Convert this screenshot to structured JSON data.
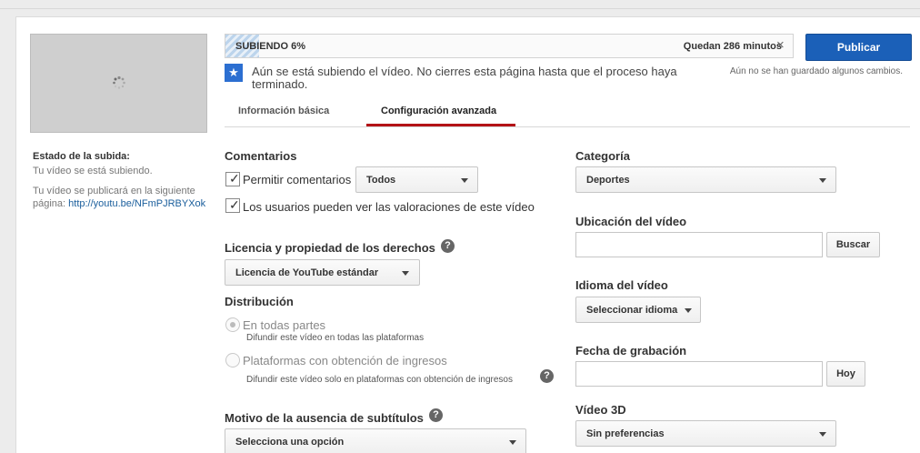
{
  "upload": {
    "status_label": "SUBIENDO 6%",
    "progress": 0.06,
    "remaining": "Quedan 286 minutos",
    "close_glyph": "×",
    "notice": "Aún se está subiendo el vídeo. No cierres esta página hasta que el proceso haya terminado."
  },
  "header": {
    "publish_label": "Publicar",
    "unsaved_note": "Aún no se han guardado algunos cambios."
  },
  "sidebar": {
    "status_title": "Estado de la subida:",
    "status_text": "Tu vídeo se está subiendo.",
    "publish_text": "Tu vídeo se publicará en la siguiente página:",
    "publish_link": "http://youtu.be/NFmPJRBYXok"
  },
  "tabs": [
    {
      "label": "Información básica",
      "active": false
    },
    {
      "label": "Configuración avanzada",
      "active": true
    }
  ],
  "comments": {
    "title": "Comentarios",
    "allow_label": "Permitir comentarios",
    "allow_checked": true,
    "allow_select": "Todos",
    "ratings_label": "Los usuarios pueden ver las valoraciones de este vídeo",
    "ratings_checked": true
  },
  "license": {
    "title": "Licencia y propiedad de los derechos",
    "select": "Licencia de YouTube estándar"
  },
  "distribution": {
    "title": "Distribución",
    "options": [
      {
        "label": "En todas partes",
        "desc": "Difundir este vídeo en todas las plataformas",
        "selected": true
      },
      {
        "label": "Plataformas con obtención de ingresos",
        "desc": "Difundir este vídeo solo en plataformas con obtención de ingresos",
        "selected": false
      }
    ]
  },
  "subtitles": {
    "title": "Motivo de la ausencia de subtítulos",
    "select": "Selecciona una opción"
  },
  "category": {
    "title": "Categoría",
    "select": "Deportes"
  },
  "location": {
    "title": "Ubicación del vídeo",
    "value": "",
    "button": "Buscar"
  },
  "language": {
    "title": "Idioma del vídeo",
    "select": "Seleccionar idioma"
  },
  "recording_date": {
    "title": "Fecha de grabación",
    "value": "",
    "button": "Hoy"
  },
  "video3d": {
    "title": "Vídeo 3D",
    "select": "Sin preferencias"
  },
  "help_glyph": "?",
  "info_glyph": "★",
  "colors": {
    "publish": "#1b60b8",
    "tab_underline": "#b31217",
    "info_icon": "#2c6fd1"
  }
}
